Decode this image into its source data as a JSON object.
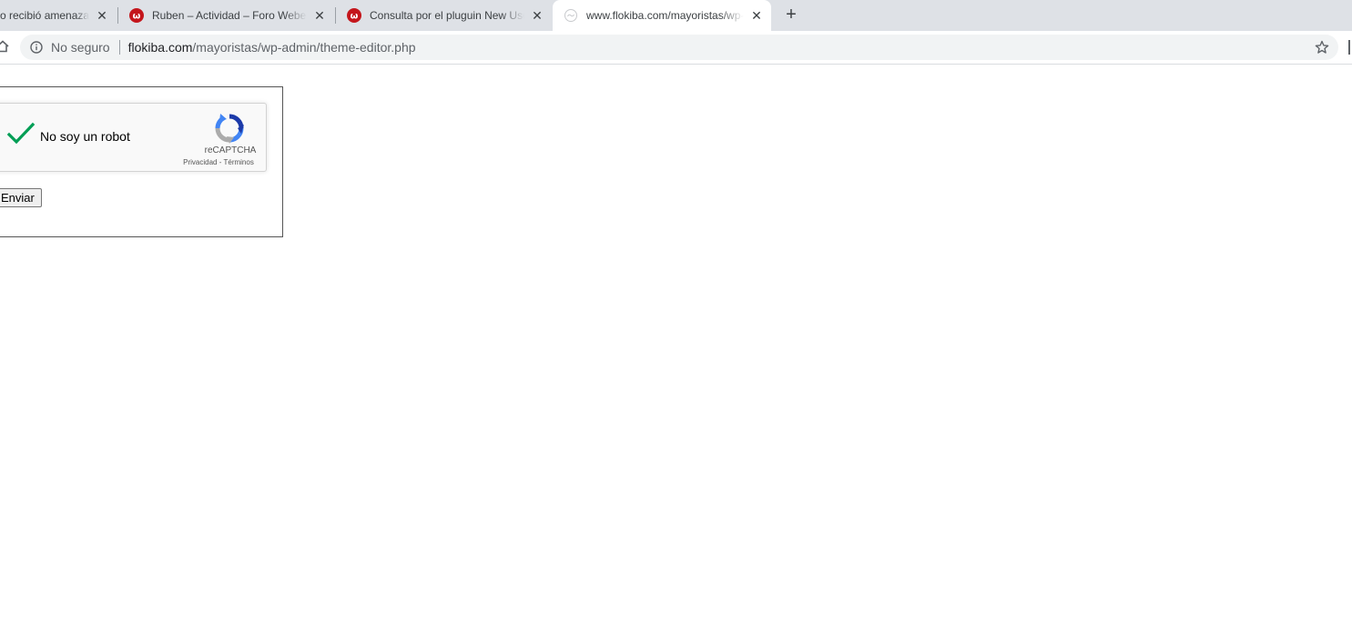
{
  "browser": {
    "tabs": [
      {
        "title": "o recibió amenazas",
        "favicon": "generic",
        "active": false
      },
      {
        "title": "Ruben – Actividad – Foro Webempresa",
        "favicon": "webempresa-logo",
        "active": false
      },
      {
        "title": "Consulta por el pluguin New User",
        "favicon": "webempresa-logo",
        "active": false
      },
      {
        "title": "www.flokiba.com/mayoristas/wp-admin",
        "favicon": "globe-placeholder",
        "active": true
      }
    ],
    "new_tab_label": "+",
    "close_glyph": "✕",
    "omnibox": {
      "security_label": "No seguro",
      "url_host": "flokiba.com",
      "url_path": "/mayoristas/wp-admin/theme-editor.php"
    }
  },
  "page": {
    "recaptcha": {
      "checkbox_label": "No soy un robot",
      "checked": true,
      "brand": "reCAPTCHA",
      "privacy_link": "Privacidad",
      "separator": " - ",
      "terms_link": "Términos"
    },
    "submit_label": "Enviar"
  },
  "colors": {
    "tabstrip_bg": "#dee1e6",
    "omnibox_bg": "#f1f3f4",
    "check_green": "#009e55",
    "webempresa_red": "#c4161c"
  }
}
